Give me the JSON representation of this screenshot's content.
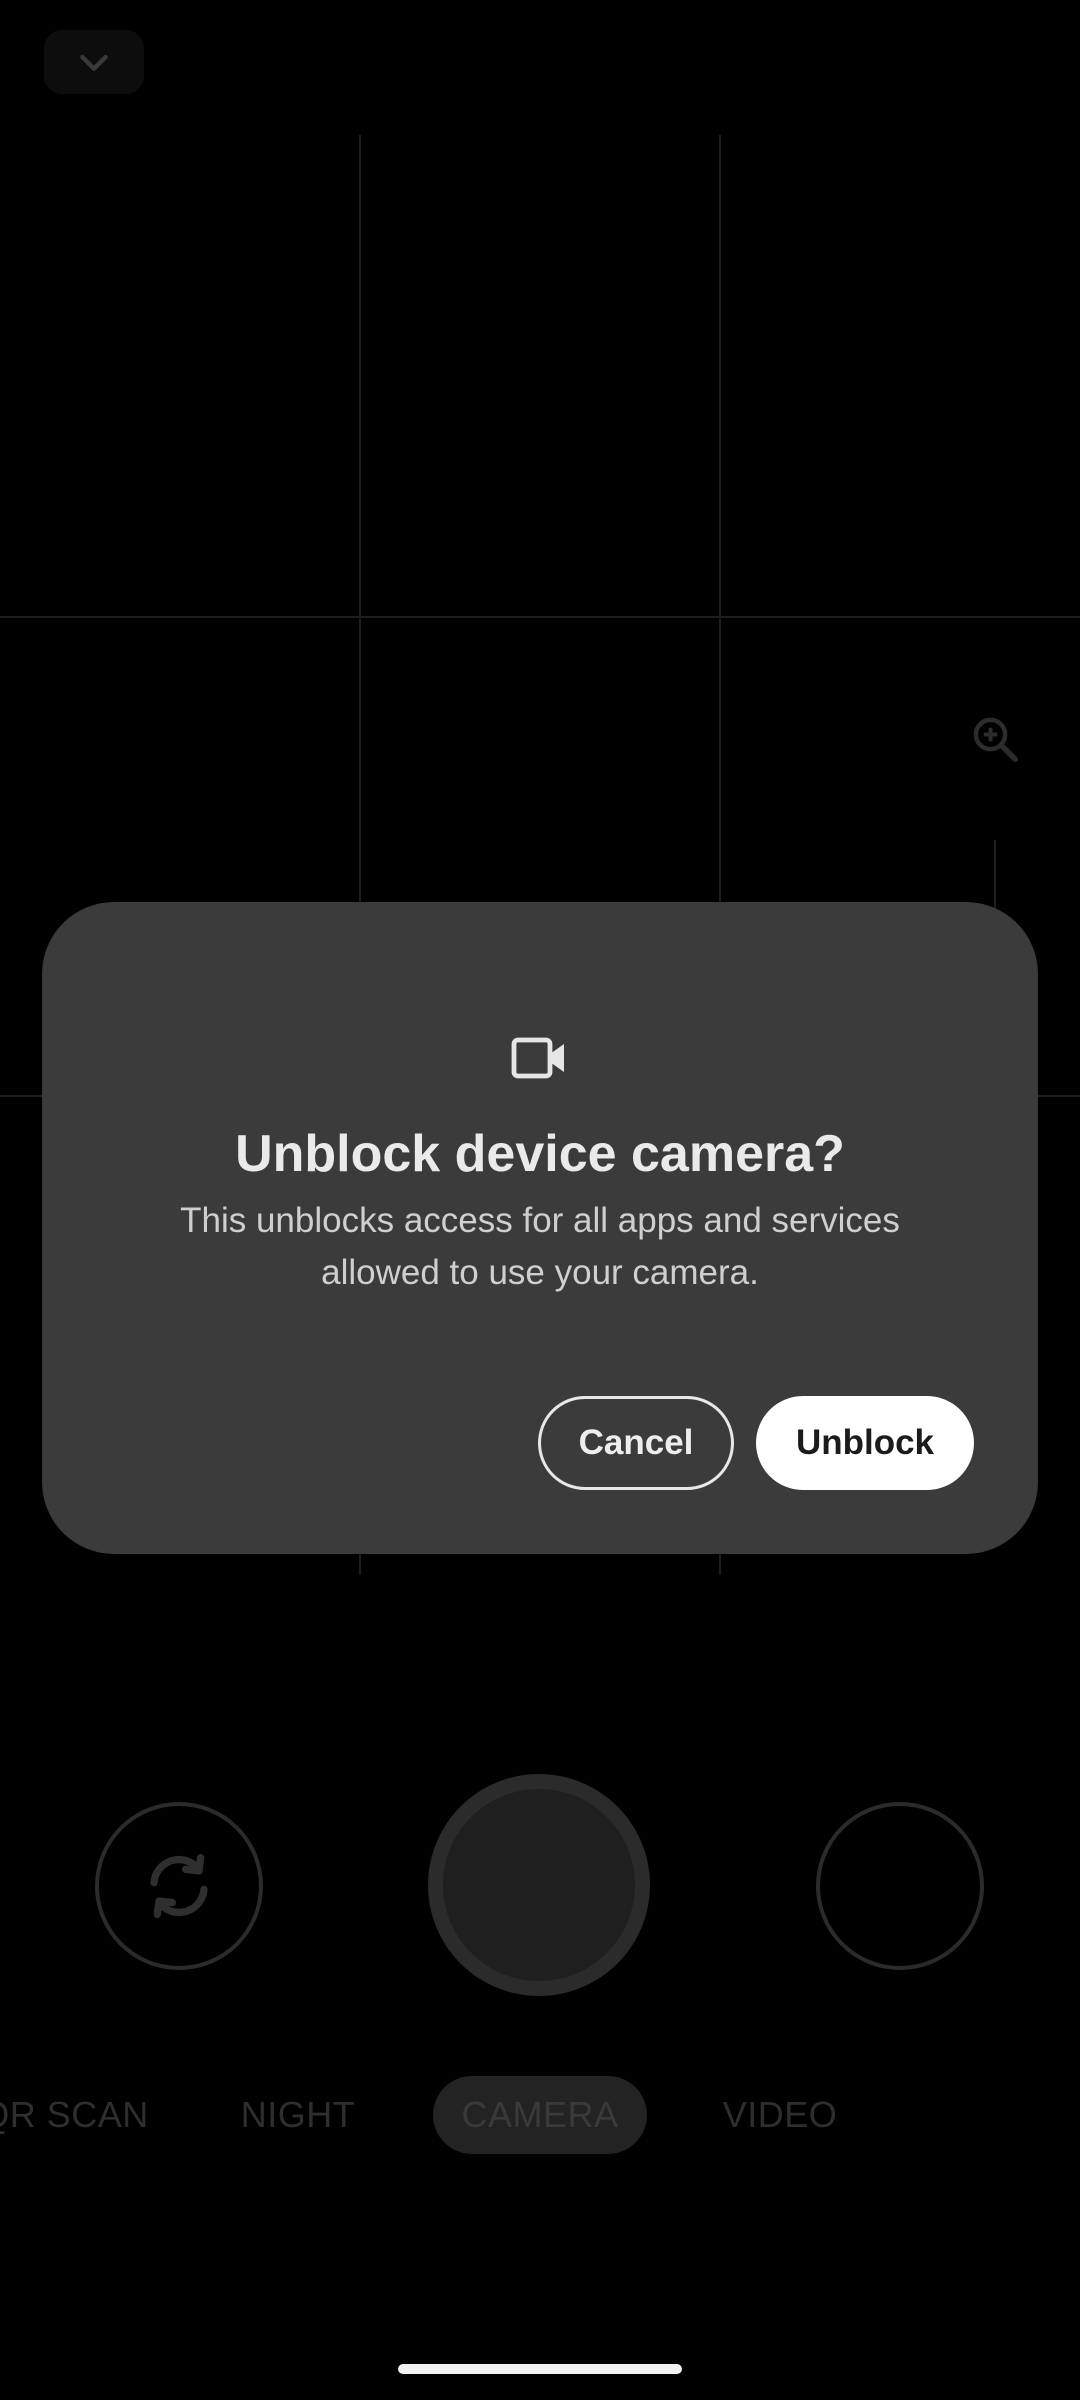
{
  "dialog": {
    "icon": "video-camera-icon",
    "title": "Unblock device camera?",
    "body": "This unblocks access for all apps and services allowed to use your camera.",
    "cancel_label": "Cancel",
    "confirm_label": "Unblock"
  },
  "camera": {
    "top_icon": "chevron-down-icon",
    "zoom_icon": "zoom-in-icon",
    "flip_icon": "switch-camera-icon",
    "modes": [
      {
        "label": "QR SCAN"
      },
      {
        "label": "NIGHT"
      },
      {
        "label": "CAMERA"
      },
      {
        "label": "VIDEO"
      }
    ],
    "active_mode": "CAMERA"
  }
}
